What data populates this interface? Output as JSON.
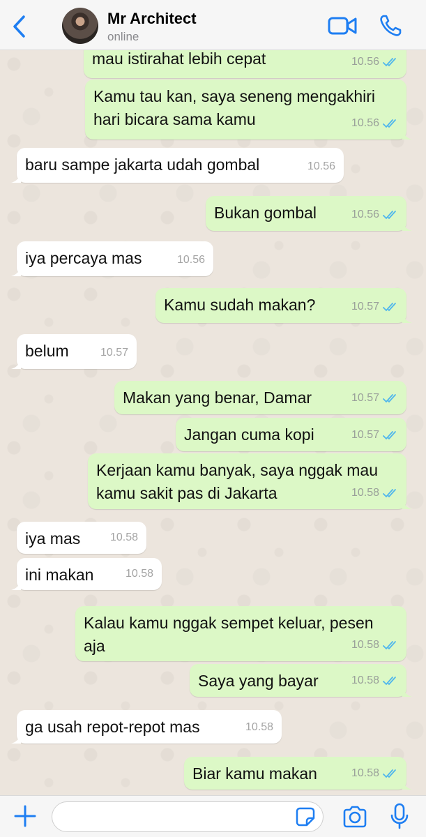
{
  "header": {
    "name": "Mr Architect",
    "status": "online"
  },
  "colors": {
    "accent": "#1e7ef2",
    "outgoing_bubble": "#dcf8c6",
    "incoming_bubble": "#ffffff",
    "read_ticks": "#4fb6ec",
    "chat_background": "#ece5dd"
  },
  "icons": {
    "back": "chevron-left-icon",
    "video": "video-camera-icon",
    "call": "phone-icon",
    "attach": "plus-icon",
    "sticker": "sticker-icon",
    "camera": "camera-icon",
    "mic": "microphone-icon"
  },
  "messages": [
    {
      "dir": "out",
      "text": "mau istirahat lebih cepat",
      "time": "10.56",
      "read": true
    },
    {
      "dir": "out",
      "text": "Kamu tau kan, saya seneng mengakhiri\nhari bicara sama kamu",
      "time": "10.56",
      "read": true
    },
    {
      "dir": "in",
      "text": "baru sampe jakarta udah gombal",
      "time": "10.56"
    },
    {
      "dir": "out",
      "text": "Bukan gombal",
      "time": "10.56",
      "read": true
    },
    {
      "dir": "in",
      "text": "iya percaya mas",
      "time": "10.56"
    },
    {
      "dir": "out",
      "text": "Kamu sudah makan?",
      "time": "10.57",
      "read": true
    },
    {
      "dir": "in",
      "text": "belum",
      "time": "10.57"
    },
    {
      "dir": "out",
      "text": "Makan yang benar, Damar",
      "time": "10.57",
      "read": true
    },
    {
      "dir": "out",
      "text": "Jangan cuma kopi",
      "time": "10.57",
      "read": true
    },
    {
      "dir": "out",
      "text": "Kerjaan kamu banyak, saya nggak mau\nkamu sakit pas di Jakarta",
      "time": "10.58",
      "read": true
    },
    {
      "dir": "in",
      "text": "iya mas",
      "time": "10.58"
    },
    {
      "dir": "in",
      "text": "ini makan",
      "time": "10.58"
    },
    {
      "dir": "out",
      "text": "Kalau kamu nggak sempet keluar, pesen\naja",
      "time": "10.58",
      "read": true
    },
    {
      "dir": "out",
      "text": "Saya yang bayar",
      "time": "10.58",
      "read": true
    },
    {
      "dir": "in",
      "text": "ga usah repot-repot mas",
      "time": "10.58"
    },
    {
      "dir": "out",
      "text": "Biar kamu makan",
      "time": "10.58",
      "read": true
    }
  ]
}
